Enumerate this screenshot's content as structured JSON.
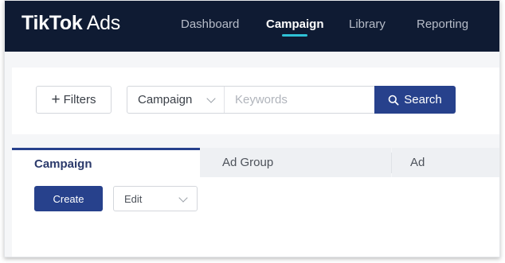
{
  "app": {
    "logo_bold": "TikTok",
    "logo_light": " Ads"
  },
  "nav": {
    "items": [
      {
        "label": "Dashboard",
        "active": false
      },
      {
        "label": "Campaign",
        "active": true
      },
      {
        "label": "Library",
        "active": false
      },
      {
        "label": "Reporting",
        "active": false
      }
    ]
  },
  "filters": {
    "filters_label": "Filters",
    "scope_value": "Campaign",
    "keywords_placeholder": "Keywords",
    "keywords_value": "",
    "search_label": "Search"
  },
  "tabs": [
    {
      "label": "Campaign",
      "active": true
    },
    {
      "label": "Ad Group",
      "active": false
    },
    {
      "label": "Ad",
      "active": false
    }
  ],
  "actions": {
    "create_label": "Create",
    "edit_value": "Edit"
  },
  "colors": {
    "topbar": "#0f1b33",
    "accent": "#27418c",
    "nav_underline": "#2fc1d6"
  },
  "icons": [
    "plus-icon",
    "chevron-down-icon",
    "search-icon"
  ]
}
